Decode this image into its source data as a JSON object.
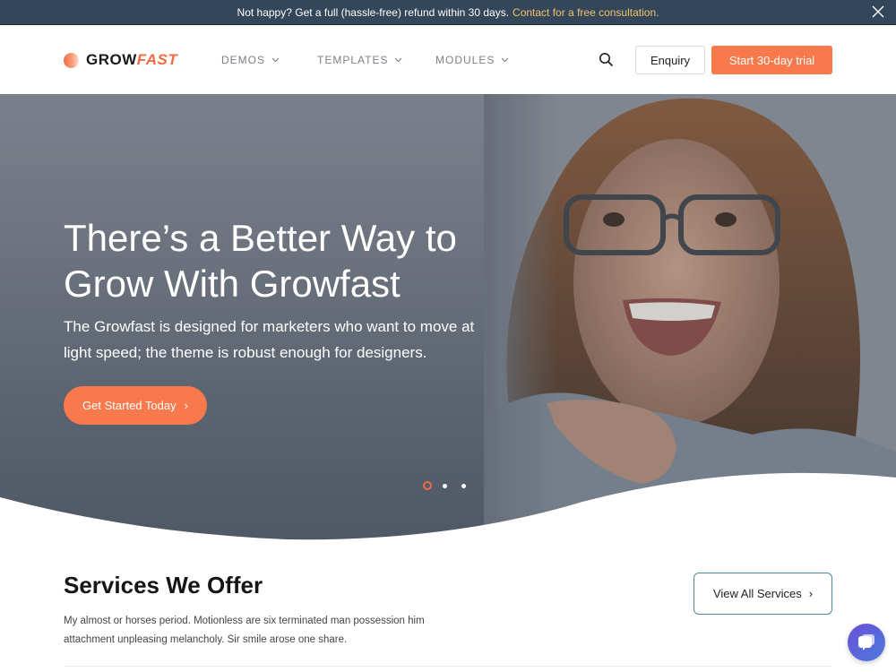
{
  "announcement": {
    "text": "Not happy? Get a full (hassle-free) refund within 30 days.",
    "link": "Contact for a free consultation.",
    "close_icon": "close-icon"
  },
  "header": {
    "logo": {
      "part1": "GROW",
      "part2": "FAST"
    },
    "nav": [
      {
        "label": "DEMOS",
        "icon": "chevron-down-icon"
      },
      {
        "label": "TEMPLATES",
        "icon": "chevron-down-icon"
      },
      {
        "label": "MODULES",
        "icon": "chevron-down-icon"
      }
    ],
    "search_icon": "search-icon",
    "enquiry_label": "Enquiry",
    "trial_label": "Start 30-day trial"
  },
  "hero": {
    "title_line1": "There’s a Better Way to",
    "title_line2_prefix": "Grow With ",
    "title_highlight": "Growfast",
    "subtitle": "The Growfast is designed for marketers who want to move at light speed; the theme is robust enough for designers.",
    "cta_label": "Get Started Today",
    "cta_icon": "chevron-right-icon",
    "slides": {
      "count": 3,
      "active": 1
    }
  },
  "services": {
    "title": "Services We Offer",
    "description": "My almost or horses period. Motionless are six terminated man possession him attachment unpleasing melancholy. Sir smile arose one share.",
    "view_all_label": "View All Services"
  },
  "chat": {
    "icon": "chat-bubble-icon"
  },
  "colors": {
    "accent": "#f8794c",
    "topbar_bg": "#34465a",
    "link": "#f2c26b",
    "outline_button": "#4d8a9c"
  }
}
